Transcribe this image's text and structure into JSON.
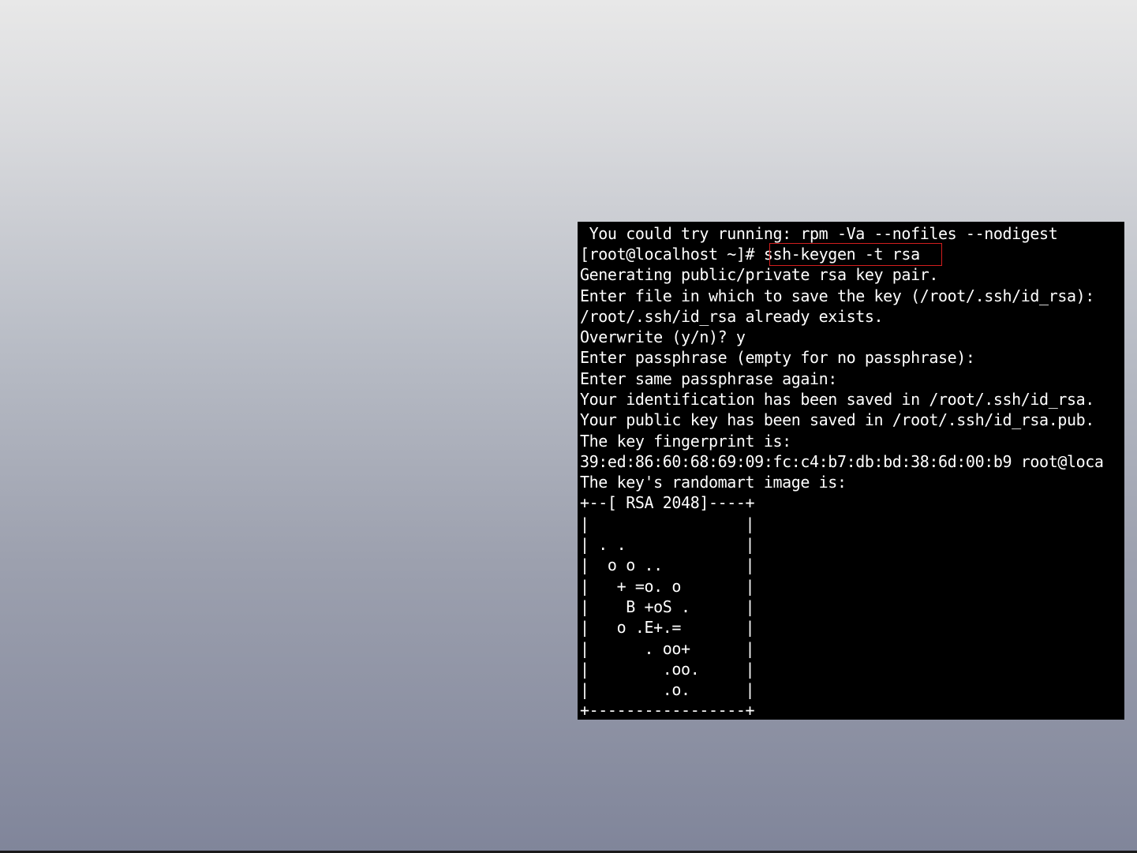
{
  "terminal": {
    "lines": [
      " You could try running: rpm -Va --nofiles --nodigest",
      "[root@localhost ~]# ssh-keygen -t rsa",
      "Generating public/private rsa key pair.",
      "Enter file in which to save the key (/root/.ssh/id_rsa):",
      "/root/.ssh/id_rsa already exists.",
      "Overwrite (y/n)? y",
      "Enter passphrase (empty for no passphrase):",
      "Enter same passphrase again:",
      "Your identification has been saved in /root/.ssh/id_rsa.",
      "Your public key has been saved in /root/.ssh/id_rsa.pub.",
      "The key fingerprint is:",
      "39:ed:86:60:68:69:09:fc:c4:b7:db:bd:38:6d:00:b9 root@loca",
      "The key's randomart image is:",
      "+--[ RSA 2048]----+",
      "|                 |",
      "| . .             |",
      "|  o o ..         |",
      "|   + =o. o       |",
      "|    B +oS .      |",
      "|   o .E+.=       |",
      "|      . oo+      |",
      "|        .oo.     |",
      "|        .o.      |",
      "+-----------------+"
    ],
    "highlighted_command": "ssh-keygen -t rsa",
    "highlight_color": "#d21e1e",
    "background_color": "#000000",
    "text_color": "#ffffff"
  }
}
